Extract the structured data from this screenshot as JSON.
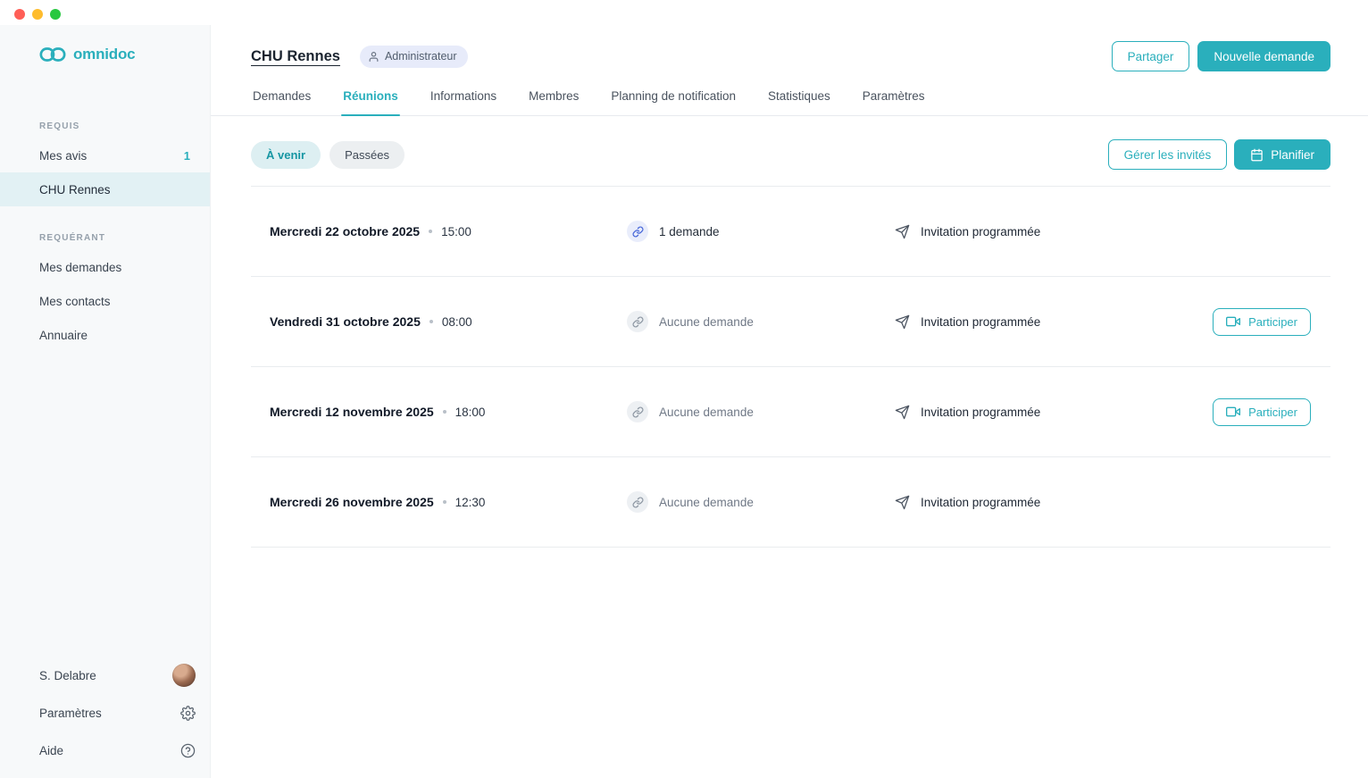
{
  "sidebar": {
    "logo": "omnidoc",
    "sections": [
      {
        "label": "REQUIS",
        "items": [
          {
            "label": "Mes avis",
            "badge": "1"
          },
          {
            "label": "CHU Rennes"
          }
        ]
      },
      {
        "label": "REQUÉRANT",
        "items": [
          {
            "label": "Mes demandes"
          },
          {
            "label": "Mes contacts"
          },
          {
            "label": "Annuaire"
          }
        ]
      }
    ],
    "footer": {
      "user": "S. Delabre",
      "settings": "Paramètres",
      "help": "Aide"
    }
  },
  "header": {
    "title": "CHU Rennes",
    "role": "Administrateur",
    "share": "Partager",
    "new_request": "Nouvelle demande"
  },
  "tabs": [
    {
      "label": "Demandes"
    },
    {
      "label": "Réunions"
    },
    {
      "label": "Informations"
    },
    {
      "label": "Membres"
    },
    {
      "label": "Planning de notification"
    },
    {
      "label": "Statistiques"
    },
    {
      "label": "Paramètres"
    }
  ],
  "filters": [
    {
      "label": "À venir"
    },
    {
      "label": "Passées"
    }
  ],
  "toolbar": {
    "manage_guests": "Gérer les invités",
    "schedule": "Planifier"
  },
  "join_label": "Participer",
  "meetings": [
    {
      "date": "Mercredi 22 octobre 2025",
      "time": "15:00",
      "requests": "1 demande",
      "invitation": "Invitation programmée"
    },
    {
      "date": "Vendredi 31 octobre 2025",
      "time": "08:00",
      "requests": "Aucune demande",
      "invitation": "Invitation programmée"
    },
    {
      "date": "Mercredi 12 novembre 2025",
      "time": "18:00",
      "requests": "Aucune demande",
      "invitation": "Invitation programmée"
    },
    {
      "date": "Mercredi 26 novembre 2025",
      "time": "12:30",
      "requests": "Aucune demande",
      "invitation": "Invitation programmée"
    }
  ],
  "colors": {
    "accent": "#2aafbc",
    "accent_soft": "#ddeff2",
    "accent_text": "#1796a3"
  }
}
